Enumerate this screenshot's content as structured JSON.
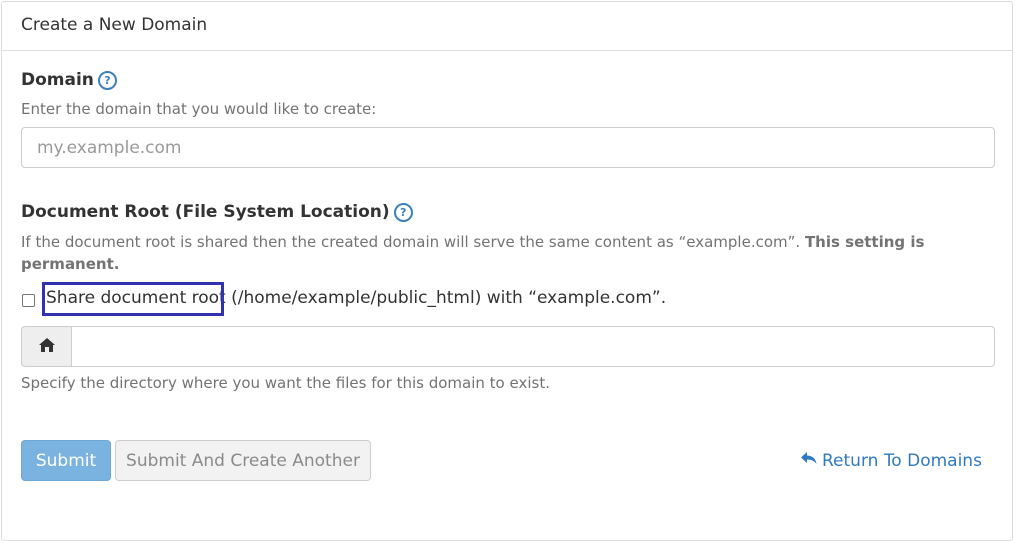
{
  "panel": {
    "title": "Create a New Domain"
  },
  "domain": {
    "label": "Domain",
    "help_icon": "question-circle-icon",
    "help_text": "Enter the domain that you would like to create:",
    "placeholder": "my.example.com",
    "value": ""
  },
  "docroot": {
    "label": "Document Root (File System Location)",
    "help_icon": "question-circle-icon",
    "description": "If the document root is shared then the created domain will serve the same content as “example.com”. ",
    "description_bold": "This setting is permanent.",
    "share_checked": false,
    "share_label_highlight": "Share document root",
    "share_label_rest": " (/home/example/public_html) with “example.com”.",
    "home_icon": "home-icon",
    "path_value": "",
    "path_help": "Specify the directory where you want the files for this domain to exist."
  },
  "actions": {
    "submit_label": "Submit",
    "submit_another_label": "Submit And Create Another",
    "return_icon": "reply-arrow-icon",
    "return_label": "Return To Domains"
  },
  "colors": {
    "accent": "#2f7ac0",
    "primary_button": "#7ab2e0",
    "highlight_border": "#3131b4"
  }
}
